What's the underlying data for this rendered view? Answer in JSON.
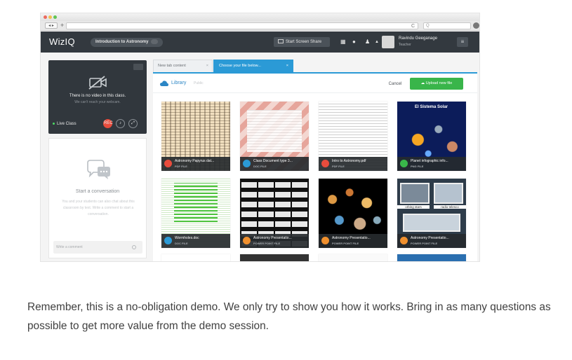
{
  "browser": {
    "nav_label": "◂ ▸",
    "new_tab": "+",
    "reload": "C",
    "search_icon": "Q"
  },
  "app": {
    "logo": "WizIQ",
    "course_title": "Introduction to Astronomy",
    "screen_share_label": "Start Screen Share",
    "user_name": "Ravindu Geeganage",
    "user_role": "Teacher",
    "menu_glyph": "≡",
    "colors": {
      "appbar": "#33393f",
      "accent": "#2b9ad6",
      "upload": "#39b54a",
      "live": "#4cd964"
    }
  },
  "video": {
    "no_video": "There is no video in this class.",
    "no_webcam": "We can't reach your webcam.",
    "live_label": "Live Class",
    "rec_label": "REC"
  },
  "chat": {
    "start_title": "Start a conversation",
    "description": "You and your students can also chat about this classroom by text. Write a comment to start a conversation.",
    "input_placeholder": "Write a comment"
  },
  "tabs": [
    {
      "label": "New tab content",
      "close": "×"
    },
    {
      "label": "Choose your file below...",
      "close": "×"
    }
  ],
  "library": {
    "title": "Library",
    "subtitle": "Public",
    "cancel_label": "Cancel",
    "upload_label": "Upload new file"
  },
  "files": [
    {
      "name": "Astronomy Papyrus dat...",
      "type": "PDF FILE",
      "icon": "pdf-icon",
      "icon_color": "#e84c3d"
    },
    {
      "name": "Class Document type 3...",
      "type": "DOC FILE",
      "icon": "doc-icon",
      "icon_color": "#2b9ad6"
    },
    {
      "name": "Intro to Astronomy.pdf",
      "type": "PDF FILE",
      "icon": "pdf-icon",
      "icon_color": "#e84c3d"
    },
    {
      "name": "Planet infographic info...",
      "type": "PNG FILE",
      "icon": "image-icon",
      "icon_color": "#39b54a",
      "thumb_title": "El Sistema Solar"
    },
    {
      "name": "Wormholes.doc",
      "type": "DOC FILE",
      "icon": "doc-icon",
      "icon_color": "#2b9ad6"
    },
    {
      "name": "Astronomy Presentatio...",
      "type": "POWER POINT FILE",
      "icon": "ppt-icon",
      "icon_color": "#f0902e"
    },
    {
      "name": "Astronomy Presentatio...",
      "type": "POWER POINT FILE",
      "icon": "ppt-icon",
      "icon_color": "#f0902e"
    },
    {
      "name": "Astronomy Presentatio...",
      "type": "POWER POINT FILE",
      "icon": "ppt-icon",
      "icon_color": "#f0902e",
      "thumb_labels": [
        "orbing stars",
        "radio telesco"
      ]
    }
  ],
  "caption": "Remember, this is a no-obligation demo. We only try to show you how it works. Bring in as many questions as possible to get more value from the demo session."
}
